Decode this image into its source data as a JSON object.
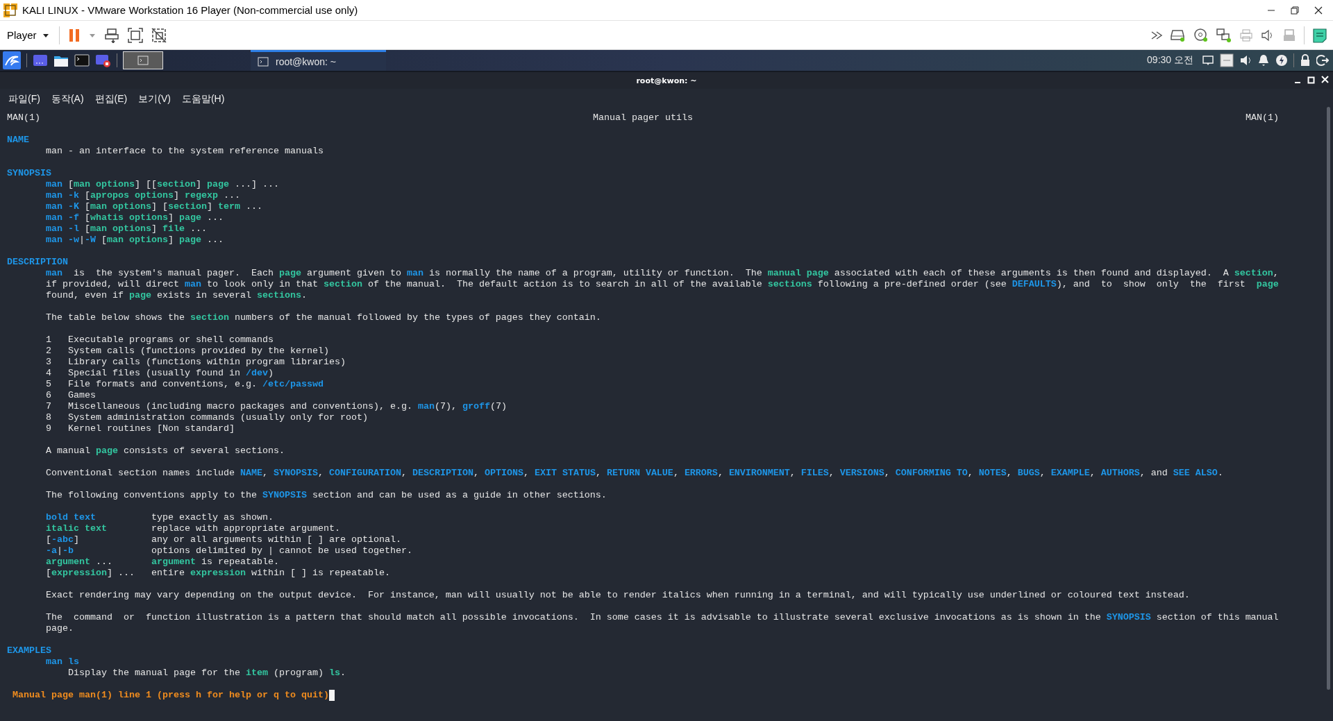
{
  "window": {
    "title": "KALI LINUX - VMware Workstation 16 Player (Non-commercial use only)"
  },
  "player_toolbar": {
    "menu": "Player"
  },
  "kali_panel": {
    "workspaces": [
      {
        "selected": true
      }
    ],
    "tasks": [
      {
        "label": "root@kwon: ~",
        "selected": true
      }
    ],
    "clock": "09:30 오전"
  },
  "terminal": {
    "title": "root@kwon: ~",
    "menu": [
      "파일(F)",
      "동작(A)",
      "편집(E)",
      "보기(V)",
      "도움말(H)"
    ],
    "page": {
      "header": {
        "left": "MAN(1)",
        "center": "Manual pager utils",
        "right": "MAN(1)"
      },
      "sections": [
        {
          "heading": "NAME",
          "paragraphs": [
            {
              "kind": "body",
              "lines": [
                "man - an interface to the system reference manuals"
              ]
            }
          ]
        },
        {
          "heading": "SYNOPSIS",
          "paragraphs": [
            {
              "kind": "body",
              "lines": [
                "**man** [*man options*] [[*section*] *page* ...] ...",
                "**man -k** [*apropos options*] *regexp* ...",
                "**man -K** [*man options*] [*section*] *term* ...",
                "**man -f** [*whatis options*] *page* ...",
                "**man -l** [*man options*] *file* ...",
                "**man -w**|**-W** [*man options*] *page* ..."
              ]
            }
          ]
        },
        {
          "heading": "DESCRIPTION",
          "paragraphs": [
            {
              "kind": "body",
              "lines": [
                "**man**  is  the system's manual pager.  Each *page* argument given to **man** is normally the name of a program, utility or function.  The *manual page* associated with each of these arguments is then found and displayed.  A *section*,",
                "if provided, will direct **man** to look only in that *section* of the manual.  The default action is to search in all of the available *sections* following a pre-defined order (see **DEFAULTS**), and  to  show  only  the  first  *page*",
                "found, even if *page* exists in several *sections*."
              ]
            },
            {
              "kind": "body",
              "lines": [
                "The table below shows the *section* numbers of the manual followed by the types of pages they contain."
              ]
            },
            {
              "kind": "body",
              "lines": [
                "1   Executable programs or shell commands",
                "2   System calls (functions provided by the kernel)",
                "3   Library calls (functions within program libraries)",
                "4   Special files (usually found in **/dev**)",
                "5   File formats and conventions, e.g. **/etc/passwd**",
                "6   Games",
                "7   Miscellaneous (including macro packages and conventions), e.g. **man**(7), **groff**(7)",
                "8   System administration commands (usually only for root)",
                "9   Kernel routines [Non standard]"
              ]
            },
            {
              "kind": "body",
              "lines": [
                "A manual *page* consists of several sections."
              ]
            },
            {
              "kind": "body",
              "lines": [
                "Conventional section names include **NAME**, **SYNOPSIS**, **CONFIGURATION**, **DESCRIPTION**, **OPTIONS**, **EXIT STATUS**, **RETURN VALUE**, **ERRORS**, **ENVIRONMENT**, **FILES**, **VERSIONS**, **CONFORMING TO**, **NOTES**, **BUGS**, **EXAMPLE**, **AUTHORS**, and **SEE ALSO**."
              ]
            },
            {
              "kind": "body",
              "lines": [
                "The following conventions apply to the **SYNOPSIS** section and can be used as a guide in other sections."
              ]
            },
            {
              "kind": "body",
              "lines": [
                "**bold text**          type exactly as shown.",
                "*italic text*        replace with appropriate argument.",
                "[**-abc**]             any or all arguments within [ ] are optional.",
                "**-a**|**-b**              options delimited by | cannot be used together.",
                "*argument* ...       *argument* is repeatable.",
                "[*expression*] ...   entire *expression* within [ ] is repeatable."
              ]
            },
            {
              "kind": "body",
              "lines": [
                "Exact rendering may vary depending on the output device.  For instance, man will usually not be able to render italics when running in a terminal, and will typically use underlined or coloured text instead."
              ]
            },
            {
              "kind": "body",
              "lines": [
                "The  command  or  function illustration is a pattern that should match all possible invocations.  In some cases it is advisable to illustrate several exclusive invocations as is shown in the **SYNOPSIS** section of this manual",
                "page."
              ]
            }
          ]
        },
        {
          "heading": "EXAMPLES",
          "paragraphs": [
            {
              "kind": "body",
              "lines": [
                "**man ls**"
              ]
            },
            {
              "kind": "nested",
              "lines": [
                "Display the manual page for the *item* (program) *ls*."
              ]
            }
          ]
        }
      ]
    },
    "status": "Manual page man(1) line 1 (press h for help or q to quit)"
  }
}
